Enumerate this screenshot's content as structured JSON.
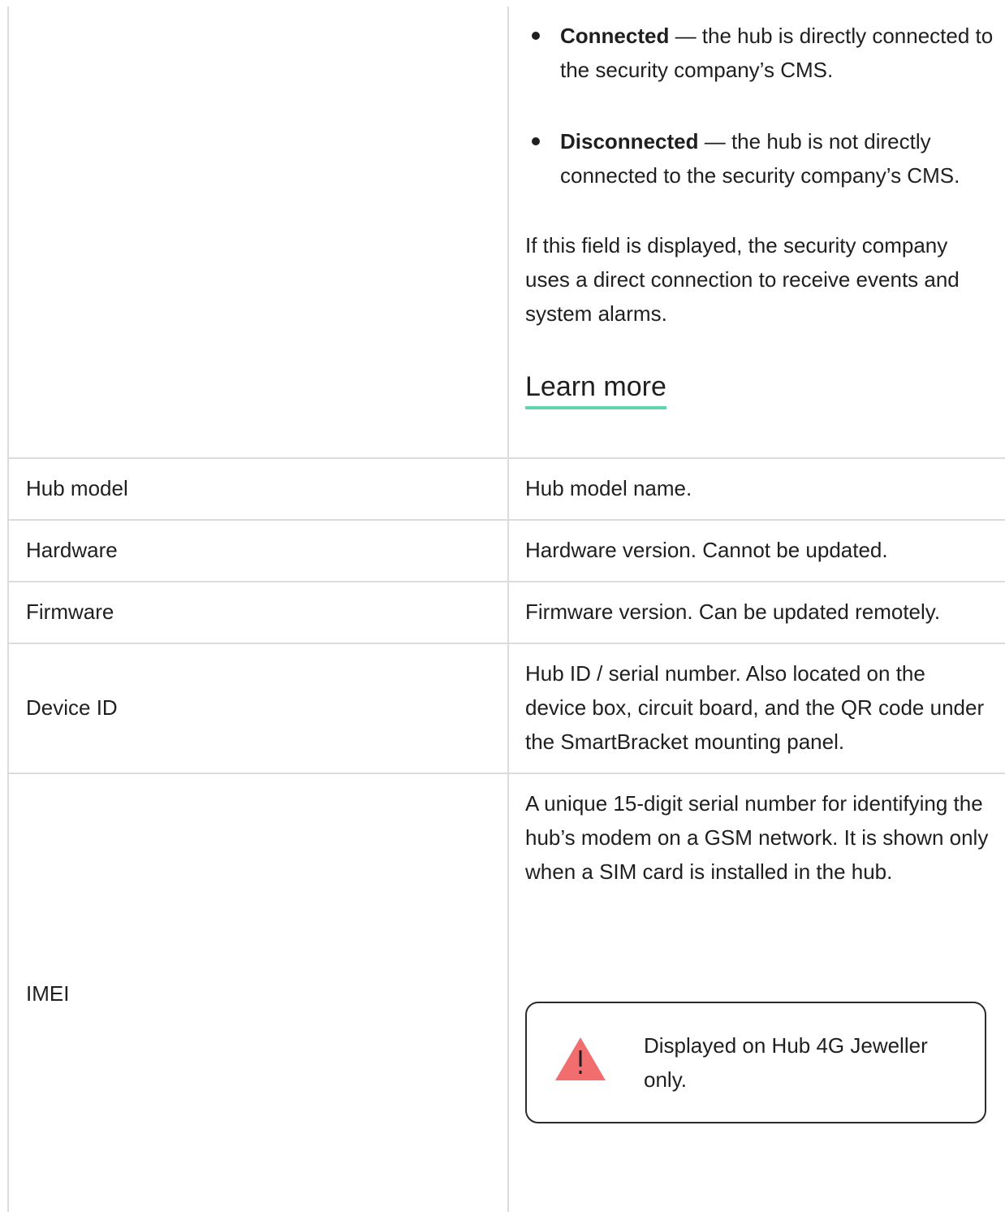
{
  "bullets": [
    {
      "label": "Connected",
      "text": " — the hub is directly connected to the security company’s CMS."
    },
    {
      "label": "Disconnected",
      "text": " — the hub is not directly connected to the security company’s CMS."
    }
  ],
  "direct_connection_note": "If this field is displayed, the security company uses a direct connection to receive events and system alarms.",
  "learn_more": "Learn more",
  "rows": [
    {
      "name": "Hub model",
      "description": "Hub model name."
    },
    {
      "name": "Hardware",
      "description": "Hardware version. Cannot be updated."
    },
    {
      "name": "Firmware",
      "description": "Firmware version. Can be updated remotely."
    },
    {
      "name": "Device ID",
      "description": "Hub ID / serial number. Also located on the device box, circuit board, and the QR code under the SmartBracket mounting panel."
    },
    {
      "name": "IMEI",
      "description": "A unique 15-digit serial number for identifying the hub’s modem on a GSM network. It is shown only when a SIM card is installed in the hub."
    }
  ],
  "note": {
    "icon": "warning-icon",
    "text": "Displayed on Hub 4G Jeweller only.",
    "icon_color": "#f26d6d"
  },
  "colors": {
    "link_underline": "#5fd6b0",
    "grid": "#dcdcdc"
  }
}
